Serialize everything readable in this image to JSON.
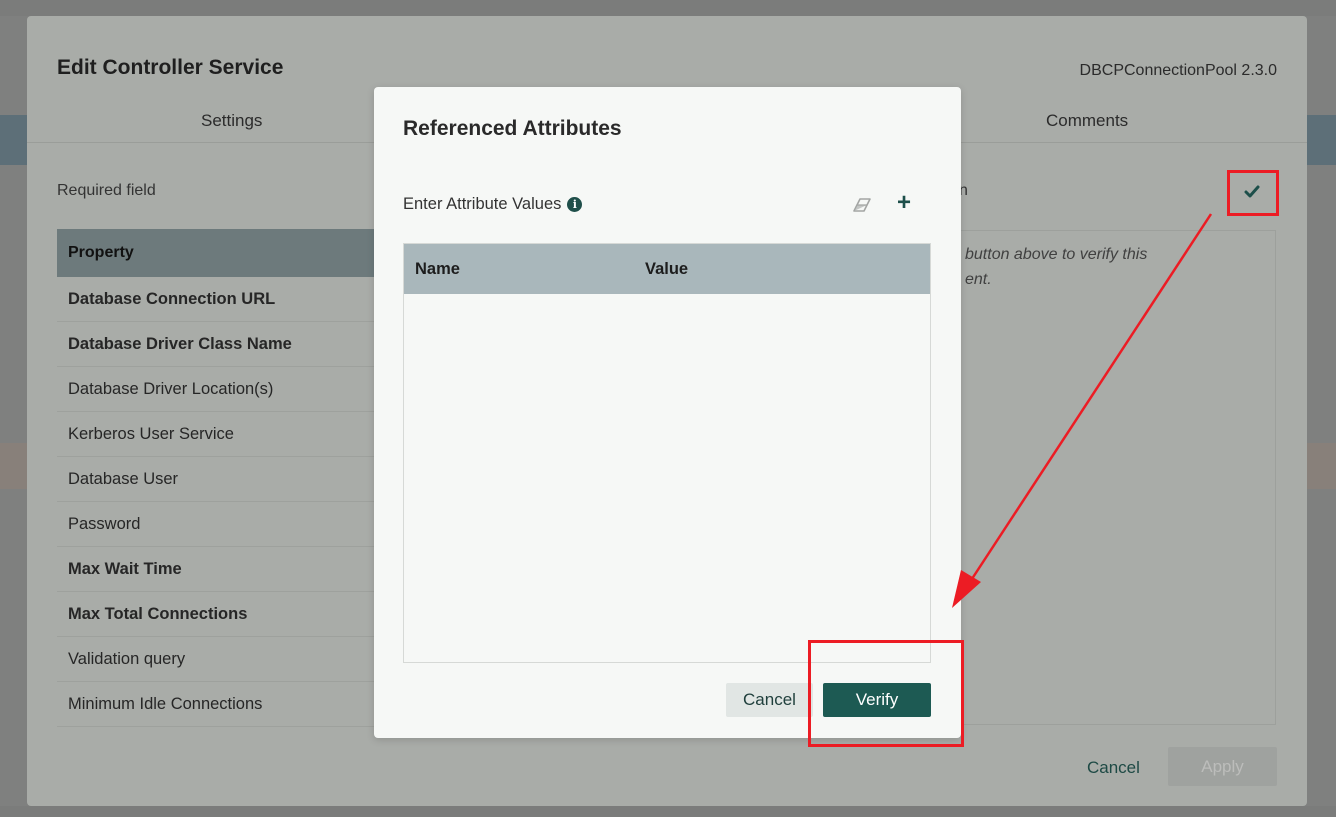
{
  "outer_dialog": {
    "title": "Edit Controller Service",
    "version": "DBCPConnectionPool 2.3.0",
    "tabs": [
      {
        "label": "Settings"
      },
      {
        "label": "Comments"
      }
    ],
    "required_field_label": "Required field",
    "property_table": {
      "header": "Property",
      "rows": [
        {
          "label": "Database Connection URL",
          "required": true
        },
        {
          "label": "Database Driver Class Name",
          "required": true
        },
        {
          "label": "Database Driver Location(s)",
          "required": false
        },
        {
          "label": "Kerberos User Service",
          "required": false
        },
        {
          "label": "Database User",
          "required": false
        },
        {
          "label": "Password",
          "required": false
        },
        {
          "label": "Max Wait Time",
          "required": true
        },
        {
          "label": "Max Total Connections",
          "required": true
        },
        {
          "label": "Validation query",
          "required": false
        },
        {
          "label": "Minimum Idle Connections",
          "required": false
        }
      ]
    },
    "verification_label_partial": "n",
    "verification_hint": "button above to verify this\nent.",
    "cancel_label": "Cancel",
    "apply_label": "Apply"
  },
  "modal": {
    "title": "Referenced Attributes",
    "enter_values_label": "Enter Attribute Values",
    "info_icon": "info-circle-icon",
    "clear_icon": "eraser-icon",
    "add_icon": "plus-icon",
    "table": {
      "columns": [
        "Name",
        "Value"
      ],
      "rows": []
    },
    "cancel_label": "Cancel",
    "verify_label": "Verify"
  },
  "colors": {
    "accent": "#1d5a53",
    "annotation": "#ec1c24",
    "table_header": "#a9b7bb"
  }
}
